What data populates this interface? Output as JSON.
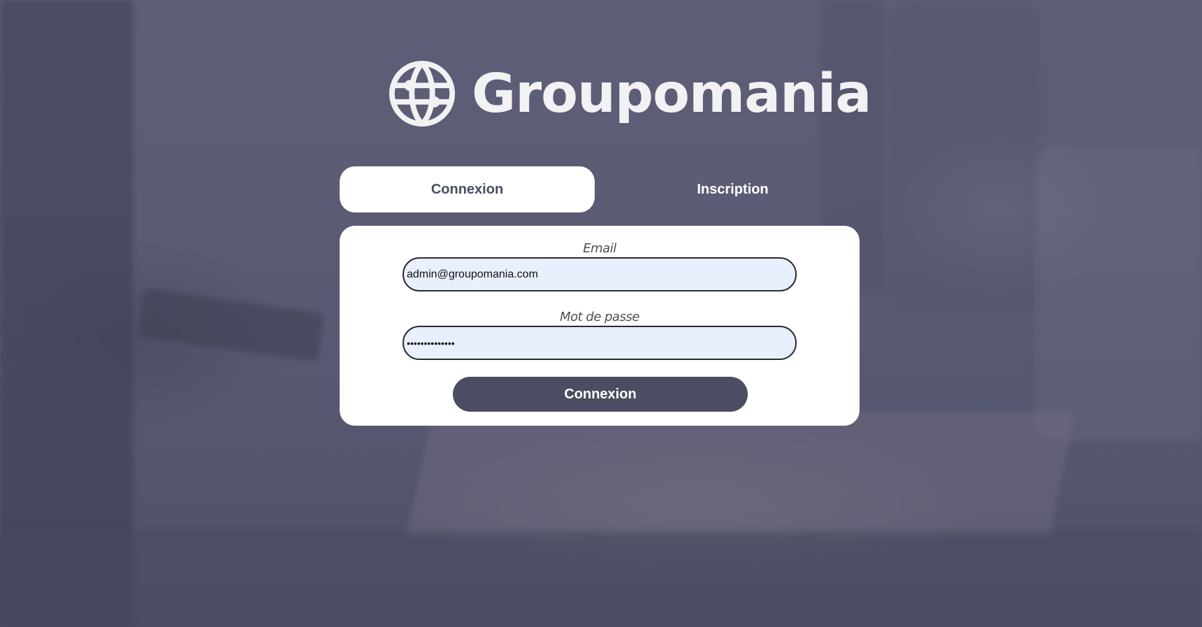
{
  "app": {
    "logo_text": "Groupomania",
    "logo_icon": "globe-icon",
    "text_color": "#f2f1f3",
    "background_overlay": "#5a5c74"
  },
  "tabs": [
    {
      "label": "Connexion",
      "active": true
    },
    {
      "label": "Inscription",
      "active": false
    }
  ],
  "login_form": {
    "email_label": "Email",
    "email_value": "admin@groupomania.com",
    "password_label": "Mot de passe",
    "password_value": "••••••••••••••",
    "submit_label": "Connexion",
    "accent_color": "#4b4d62",
    "input_fill": "#e8f0fe"
  }
}
